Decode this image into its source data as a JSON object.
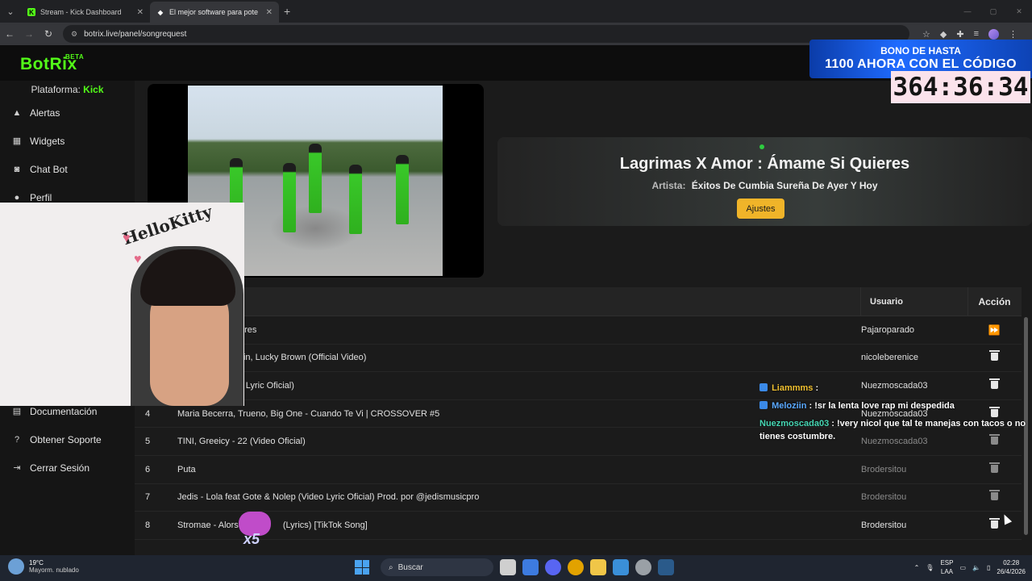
{
  "browser": {
    "tabs": [
      {
        "title": "Stream - Kick Dashboard",
        "active": false,
        "favicon_color": "#53fc18"
      },
      {
        "title": "El mejor software para pote",
        "active": true,
        "favicon_color": "#ffffff"
      }
    ],
    "url": "botrix.live/panel/songrequest"
  },
  "app": {
    "logo": "BotRix",
    "logo_badge": "BETA",
    "promo": {
      "line1": "BONO DE HASTA",
      "line2": "1100 AHORA CON EL CÓDIGO"
    }
  },
  "sidebar": {
    "platform_label": "Plataforma:",
    "platform_value": "Kick",
    "items": [
      {
        "label": "Alertas",
        "icon": "warning-icon"
      },
      {
        "label": "Widgets",
        "icon": "grid-icon"
      },
      {
        "label": "Chat Bot",
        "icon": "robot-icon"
      },
      {
        "label": "Perfil",
        "icon": "user-icon"
      },
      {
        "label": "Documentación",
        "icon": "book-icon"
      },
      {
        "label": "Obtener Soporte",
        "icon": "help-icon"
      },
      {
        "label": "Cerrar Sesión",
        "icon": "logout-icon"
      }
    ]
  },
  "now_playing": {
    "title": "Lagrimas X Amor : Ámame Si Quieres",
    "artist_label": "Artista:",
    "artist": "Éxitos De Cumbia Sureña De Ayer Y Hoy",
    "settings_button": "Ajustes"
  },
  "timer": "364:36:34",
  "queue": {
    "headers": {
      "user": "Usuario",
      "action": "Acción"
    },
    "rows": [
      {
        "num": "",
        "song": ": Ámame Si Quieres",
        "user": "Pajaroparado",
        "action": "skip"
      },
      {
        "num": "",
        "song": "atteyes, Jere Klein, Lucky Brown (Official Video)",
        "user": "nicoleberenice",
        "action": "delete"
      },
      {
        "num": "",
        "song": "- Conejita (Video Lyric Oficial)",
        "user": "Nuezmoscada03",
        "action": "delete"
      },
      {
        "num": "4",
        "song": "Maria Becerra, Trueno, Big One - Cuando Te Vi | CROSSOVER #5",
        "user": "Nuezmoscada03",
        "action": "delete"
      },
      {
        "num": "5",
        "song": "TINI, Greeicy - 22 (Video Oficial)",
        "user": "Nuezmoscada03",
        "action": "delete"
      },
      {
        "num": "6",
        "song": "Puta",
        "user": "Brodersitou",
        "action": "delete"
      },
      {
        "num": "7",
        "song": "Jedis - Lola feat Gote & Nolep (Video Lyric Oficial) Prod. por @jedismusicpro",
        "user": "Brodersitou",
        "action": "delete"
      },
      {
        "num": "8",
        "song": "Stromae - Alors                  (Lyrics) [TikTok Song]",
        "user": "Brodersitou",
        "action": "delete"
      }
    ]
  },
  "overlay": {
    "webcam_sticker": "HelloKitty",
    "sticker_multiplier": "x5",
    "chat": [
      {
        "user": "Liammms",
        "sep": " :",
        "text": ""
      },
      {
        "user": "Meloziin",
        "sep": " :",
        "text": " !sr la lenta love rap mi despedida"
      },
      {
        "user": "Nuezmoscada03",
        "sep": " :",
        "text": " !very nicol que tal te manejas con tacos o no tienes costumbre."
      }
    ]
  },
  "taskbar": {
    "temperature": "19°C",
    "weather": "Mayorm. nublado",
    "search": "Buscar",
    "lang1": "ESP",
    "lang2": "LAA",
    "time": "02:28",
    "date": "26/4/2026"
  }
}
